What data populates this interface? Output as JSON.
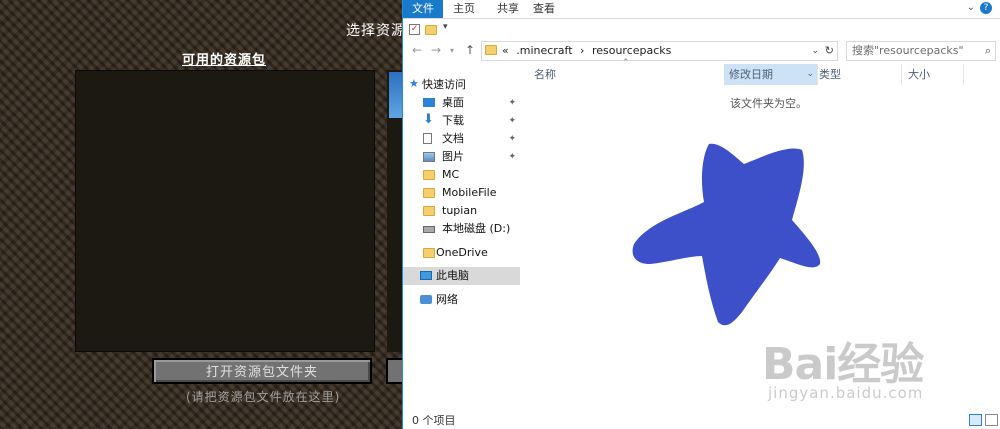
{
  "minecraft": {
    "title": "选择资源",
    "list_label": "可用的资源包",
    "open_folder_button": "打开资源包文件夹",
    "hint": "(请把资源包文件放在这里)"
  },
  "explorer": {
    "ribbon_tabs": [
      "文件",
      "主页",
      "共享",
      "查看"
    ],
    "address": {
      "ellipsis": "«",
      "crumbs": [
        ".minecraft",
        "resourcepacks"
      ]
    },
    "search_placeholder": "搜索\"resourcepacks\"",
    "nav_items": [
      {
        "label": "快速访问",
        "icon": "star-icon"
      },
      {
        "label": "桌面",
        "icon": "desktop-icon",
        "pinned": true
      },
      {
        "label": "下载",
        "icon": "download-icon",
        "pinned": true
      },
      {
        "label": "文档",
        "icon": "document-icon",
        "pinned": true
      },
      {
        "label": "图片",
        "icon": "picture-icon",
        "pinned": true
      },
      {
        "label": "MC",
        "icon": "folder-icon"
      },
      {
        "label": "MobileFile",
        "icon": "folder-icon"
      },
      {
        "label": "tupian",
        "icon": "folder-icon"
      },
      {
        "label": "本地磁盘 (D:)",
        "icon": "drive-icon"
      },
      {
        "label": "OneDrive",
        "icon": "folder-icon"
      },
      {
        "label": "此电脑",
        "icon": "pc-icon",
        "selected": true
      },
      {
        "label": "网络",
        "icon": "network-icon"
      }
    ],
    "columns": [
      "名称",
      "修改日期",
      "类型",
      "大小"
    ],
    "sorted_column": "修改日期",
    "empty_message": "该文件夹为空。",
    "status_count": "0 个项目"
  },
  "annotation": {
    "color": "#3d4fc9"
  },
  "watermark": {
    "logo": "Bai经验",
    "url": "jingyan.baidu.com"
  }
}
